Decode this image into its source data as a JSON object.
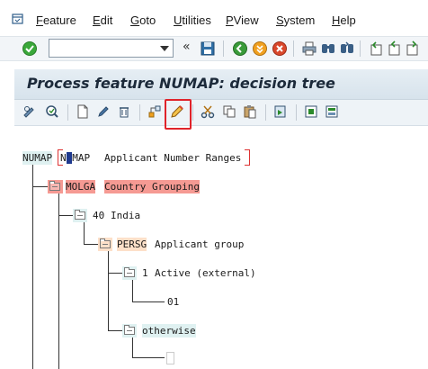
{
  "menubar": {
    "items": [
      "Feature",
      "Edit",
      "Goto",
      "Utilities",
      "PView",
      "System",
      "Help"
    ]
  },
  "toolbar": {
    "command_value": "",
    "back_symbol": "«"
  },
  "title": "Process feature NUMAP: decision tree",
  "tree": {
    "root": {
      "name": "NUMAP",
      "editable": "NUMAP",
      "label": "Applicant Number Ranges"
    },
    "molga": {
      "name": "MOLGA",
      "label": "Country Grouping"
    },
    "india": {
      "value": "40",
      "label": "India"
    },
    "persg": {
      "name": "PERSG",
      "label": "Applicant group"
    },
    "active": {
      "value": "1",
      "label": "Active (external)"
    },
    "return1": "01",
    "otherwise": "otherwise"
  },
  "colors": {
    "highlight": "#e0232a",
    "molga_bg": "#f59a93",
    "persg_bg": "#fde0c9",
    "teal_bg": "#dff1f1"
  }
}
